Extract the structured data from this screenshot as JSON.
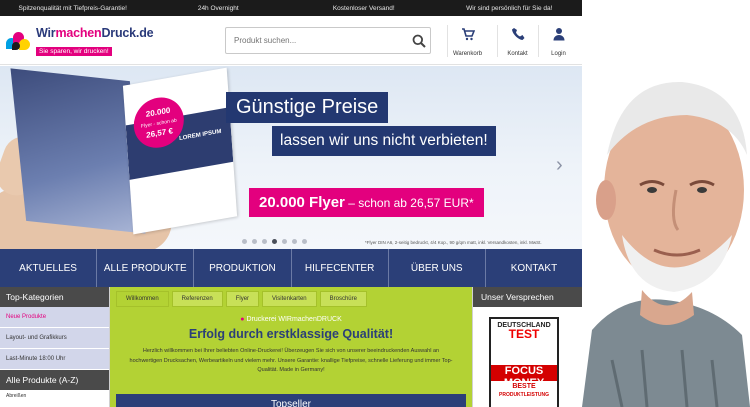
{
  "topbar": {
    "items": [
      "Spitzenqualität mit Tiefpreis-Garantie!",
      "24h Overnight",
      "Kostenloser Versand!",
      "Wir sind persönlich für Sie da!"
    ]
  },
  "header": {
    "logo_name_1": "Wir",
    "logo_name_2": "machen",
    "logo_name_3": "Druck",
    "logo_name_4": ".de",
    "slogan": "Sie sparen, wir drucken!",
    "search_placeholder": "Produkt suchen...",
    "cart_label": "Warenkorb",
    "contact_label": "Kontakt",
    "login_label": "Login"
  },
  "hero": {
    "headline": "Günstige Preise",
    "subline": "lassen wir uns nicht verbieten!",
    "offer_main": "20.000 Flyer",
    "offer_rest": " – schon ab 26,57 EUR*",
    "flyer_badge_1": "20.000",
    "flyer_badge_2": "Flyer - schon ab",
    "flyer_badge_3": "26,57 €",
    "flyer_lorem": "LOREM IPSUM",
    "footnote": "*Flyer DIN A6, 2-seitig bedruckt, 4/4 Kop., 90 g/qm matt, inkl. Versandkosten, inkl. MwSt.",
    "slide_count": 7,
    "active_slide": 4
  },
  "nav": {
    "items": [
      "AKTUELLES",
      "ALLE PRODUKTE",
      "PRODUKTION",
      "HILFECENTER",
      "ÜBER UNS",
      "KONTAKT"
    ]
  },
  "sidebar": {
    "title": "Top-Kategorien",
    "items": [
      "Neue Produkte",
      "Layout- und Grafikkurs",
      "Last-Minute 18:00 Uhr"
    ],
    "section_title": "Alle Produkte (A-Z)",
    "sub_items": [
      "Abreißen"
    ]
  },
  "center": {
    "tabs": [
      "Willkommen",
      "Referenzen",
      "Flyer",
      "Visitenkarten",
      "Broschüre"
    ],
    "tag": "Druckerei WIRmachenDRUCK",
    "title": "Erfolg durch erstklassige Qualität!",
    "text": "Herzlich willkommen bei Ihrer beliebten Online-Druckerei! Überzeugen Sie sich von unserer beeindruckenden Auswahl an hochwertigen Drucksachen, Werbeartikeln und vielem mehr. Unsere Garantie: knallige Tiefpreise, schnelle Lieferung und immer Top-Qualität. Made in Germany!",
    "topseller": "Topseller"
  },
  "rightbar": {
    "title": "Unser Versprechen",
    "badge_top": "DEUTSCHLAND",
    "badge_test": "TEST",
    "badge_money": "FOCUS MONEY",
    "badge_best_1": "BESTE",
    "badge_best_2": "PRODUKTLEISTUNG"
  },
  "colors": {
    "brand_navy": "#2b3f78",
    "brand_magenta": "#e3007e",
    "welcome_green": "#b3d234"
  }
}
